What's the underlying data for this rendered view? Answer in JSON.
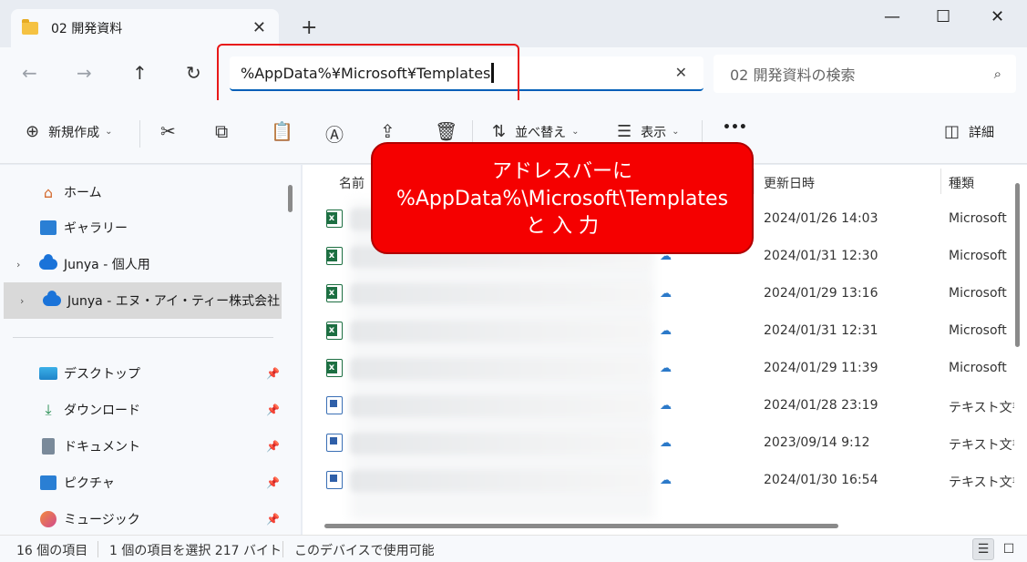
{
  "tab": {
    "title": "02 開発資料",
    "close": "✕",
    "new_tab": "+"
  },
  "window_controls": {
    "minimize": "—",
    "maximize": "☐",
    "close": "✕"
  },
  "nav": {
    "back": "←",
    "forward": "→",
    "up": "↑",
    "refresh": "↻"
  },
  "address": {
    "value": "%AppData%¥Microsoft¥Templates",
    "clear": "✕"
  },
  "search": {
    "placeholder": "02 開発資料の検索",
    "icon": "⌕"
  },
  "command_bar": {
    "new_label": "新規作成",
    "sort_label": "並べ替え",
    "view_label": "表示",
    "more_label": "•••",
    "details_label": "詳細"
  },
  "callout": {
    "line1": "アドレスバーに",
    "line2": "%AppData%\\Microsoft\\Templates",
    "line3": "と 入 力"
  },
  "sidebar": {
    "items": [
      {
        "label": "ホーム"
      },
      {
        "label": "ギャラリー"
      },
      {
        "label": "Junya - 個人用"
      },
      {
        "label": "Junya - エヌ・アイ・ティー株式会社"
      },
      {
        "label": "デスクトップ"
      },
      {
        "label": "ダウンロード"
      },
      {
        "label": "ドキュメント"
      },
      {
        "label": "ピクチャ"
      },
      {
        "label": "ミュージック"
      }
    ]
  },
  "columns": {
    "name": "名前",
    "modified": "更新日時",
    "type": "種類"
  },
  "files": [
    {
      "icon": "excel",
      "date": "2024/01/26 14:03",
      "type": "Microsoft"
    },
    {
      "icon": "excel",
      "date": "2024/01/31 12:30",
      "type": "Microsoft"
    },
    {
      "icon": "excel",
      "date": "2024/01/29 13:16",
      "type": "Microsoft"
    },
    {
      "icon": "excel",
      "date": "2024/01/31 12:31",
      "type": "Microsoft"
    },
    {
      "icon": "excel",
      "date": "2024/01/29 11:39",
      "type": "Microsoft"
    },
    {
      "icon": "text",
      "date": "2024/01/28 23:19",
      "type": "テキスト文書"
    },
    {
      "icon": "text",
      "date": "2023/09/14 9:12",
      "type": "テキスト文書"
    },
    {
      "icon": "text",
      "date": "2024/01/30 16:54",
      "type": "テキスト文書"
    }
  ],
  "status": {
    "count": "16 個の項目",
    "selected": "1 個の項目を選択 217 バイト",
    "availability": "このデバイスで使用可能"
  },
  "colors": {
    "accent": "#005fb8",
    "callout": "#f50000",
    "highlight": "#e81818"
  }
}
